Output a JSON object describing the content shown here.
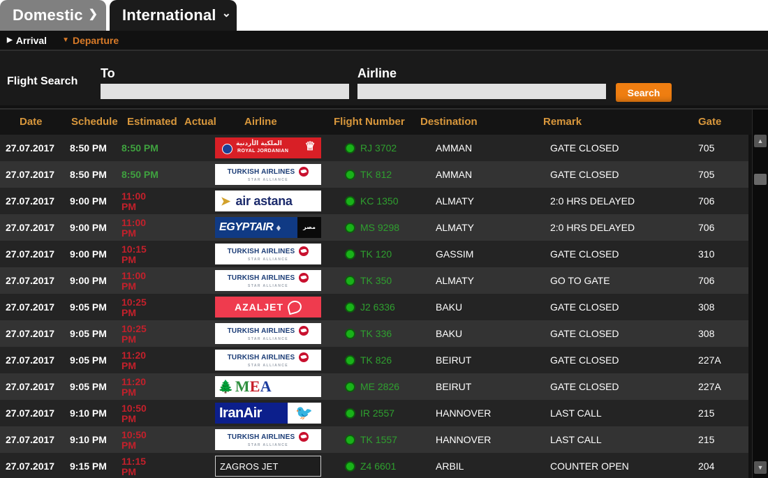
{
  "tabs": [
    {
      "label": "Domestic",
      "icon": "chevron-right-icon",
      "active": false
    },
    {
      "label": "International",
      "icon": "chevron-down-icon",
      "active": true
    }
  ],
  "subnav": [
    {
      "label": "Arrival",
      "icon": "triangle-right-icon",
      "active": false
    },
    {
      "label": "Departure",
      "icon": "triangle-down-icon",
      "active": true
    }
  ],
  "search": {
    "title": "Flight Search",
    "to_label": "To",
    "to_value": "",
    "to_placeholder": "",
    "airline_label": "Airline",
    "airline_value": "",
    "airline_placeholder": "",
    "button_label": "Search"
  },
  "colors": {
    "accent_orange": "#d8973c",
    "button_orange": "#ef7e11",
    "ontime_green": "#3fa23f",
    "delayed_red": "#c4202b",
    "flight_green": "#2fa02f",
    "tab_inactive": "#808080",
    "tab_active": "#1b1b1b"
  },
  "table": {
    "columns": [
      "Date",
      "Schedule",
      "Estimated",
      "Actual",
      "Airline",
      "Flight Number",
      "Destination",
      "Remark",
      "Gate"
    ],
    "rows": [
      {
        "date": "27.07.2017",
        "schedule": "8:50 PM",
        "estimated": "8:50 PM",
        "estimated_state": "ontime",
        "actual": "",
        "airline": "Royal Jordanian",
        "airline_logo": "royal-jordanian-logo",
        "flight": "RJ 3702",
        "destination": "AMMAN",
        "remark": "GATE CLOSED",
        "gate": "705"
      },
      {
        "date": "27.07.2017",
        "schedule": "8:50 PM",
        "estimated": "8:50 PM",
        "estimated_state": "ontime",
        "actual": "",
        "airline": "Turkish Airlines",
        "airline_logo": "turkish-airlines-logo",
        "flight": "TK 812",
        "destination": "AMMAN",
        "remark": "GATE CLOSED",
        "gate": "705"
      },
      {
        "date": "27.07.2017",
        "schedule": "9:00 PM",
        "estimated": "11:00 PM",
        "estimated_state": "late",
        "actual": "",
        "airline": "Air Astana",
        "airline_logo": "air-astana-logo",
        "flight": "KC 1350",
        "destination": "ALMATY",
        "remark": "2:0 HRS DELAYED",
        "gate": "706"
      },
      {
        "date": "27.07.2017",
        "schedule": "9:00 PM",
        "estimated": "11:00 PM",
        "estimated_state": "late",
        "actual": "",
        "airline": "EgyptAir",
        "airline_logo": "egyptair-logo",
        "flight": "MS 9298",
        "destination": "ALMATY",
        "remark": "2:0 HRS DELAYED",
        "gate": "706"
      },
      {
        "date": "27.07.2017",
        "schedule": "9:00 PM",
        "estimated": "10:15 PM",
        "estimated_state": "late",
        "actual": "",
        "airline": "Turkish Airlines",
        "airline_logo": "turkish-airlines-logo",
        "flight": "TK 120",
        "destination": "GASSIM",
        "remark": "GATE CLOSED",
        "gate": "310"
      },
      {
        "date": "27.07.2017",
        "schedule": "9:00 PM",
        "estimated": "11:00 PM",
        "estimated_state": "late",
        "actual": "",
        "airline": "Turkish Airlines",
        "airline_logo": "turkish-airlines-logo",
        "flight": "TK 350",
        "destination": "ALMATY",
        "remark": "GO TO GATE",
        "gate": "706"
      },
      {
        "date": "27.07.2017",
        "schedule": "9:05 PM",
        "estimated": "10:25 PM",
        "estimated_state": "late",
        "actual": "",
        "airline": "AZALJET",
        "airline_logo": "azaljet-logo",
        "flight": "J2 6336",
        "destination": "BAKU",
        "remark": "GATE CLOSED",
        "gate": "308"
      },
      {
        "date": "27.07.2017",
        "schedule": "9:05 PM",
        "estimated": "10:25 PM",
        "estimated_state": "late",
        "actual": "",
        "airline": "Turkish Airlines",
        "airline_logo": "turkish-airlines-logo",
        "flight": "TK 336",
        "destination": "BAKU",
        "remark": "GATE CLOSED",
        "gate": "308"
      },
      {
        "date": "27.07.2017",
        "schedule": "9:05 PM",
        "estimated": "11:20 PM",
        "estimated_state": "late",
        "actual": "",
        "airline": "Turkish Airlines",
        "airline_logo": "turkish-airlines-logo",
        "flight": "TK 826",
        "destination": "BEIRUT",
        "remark": "GATE CLOSED",
        "gate": "227A"
      },
      {
        "date": "27.07.2017",
        "schedule": "9:05 PM",
        "estimated": "11:20 PM",
        "estimated_state": "late",
        "actual": "",
        "airline": "MEA",
        "airline_logo": "mea-logo",
        "flight": "ME 2826",
        "destination": "BEIRUT",
        "remark": "GATE CLOSED",
        "gate": "227A"
      },
      {
        "date": "27.07.2017",
        "schedule": "9:10 PM",
        "estimated": "10:50 PM",
        "estimated_state": "late",
        "actual": "",
        "airline": "IranAir",
        "airline_logo": "iranair-logo",
        "flight": "IR 2557",
        "destination": "HANNOVER",
        "remark": "LAST CALL",
        "gate": "215"
      },
      {
        "date": "27.07.2017",
        "schedule": "9:10 PM",
        "estimated": "10:50 PM",
        "estimated_state": "late",
        "actual": "",
        "airline": "Turkish Airlines",
        "airline_logo": "turkish-airlines-logo",
        "flight": "TK 1557",
        "destination": "HANNOVER",
        "remark": "LAST CALL",
        "gate": "215"
      },
      {
        "date": "27.07.2017",
        "schedule": "9:15 PM",
        "estimated": "11:15 PM",
        "estimated_state": "late",
        "actual": "",
        "airline": "ZAGROS JET",
        "airline_logo": "zagros-jet-logo",
        "flight": "Z4 6601",
        "destination": "ARBIL",
        "remark": "COUNTER OPEN",
        "gate": "204"
      }
    ]
  },
  "logos": {
    "royal_jordanian": {
      "arabic": "الملكية الأردنية",
      "english": "ROYAL JORDANIAN",
      "crown": "♕"
    },
    "turkish": {
      "text": "TURKISH AIRLINES",
      "sub": "STAR ALLIANCE"
    },
    "air_astana": {
      "text": "air astana"
    },
    "egyptair": {
      "text": "EGYPTAIR",
      "box": "مصر"
    },
    "azaljet": {
      "text": "AZALJET"
    },
    "mea": {
      "m": "M",
      "e": "E",
      "a": "A"
    },
    "iranair": {
      "text": "IranAir"
    },
    "zagros": {
      "text": "ZAGROS JET"
    }
  },
  "scrollbar": {
    "up": "▲",
    "down": "▼"
  }
}
